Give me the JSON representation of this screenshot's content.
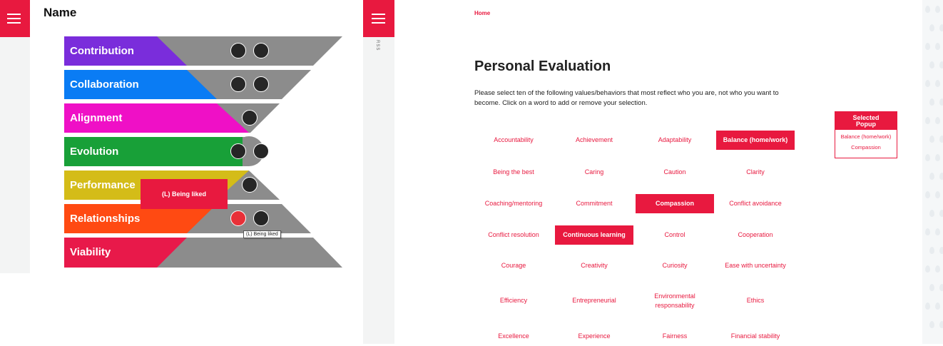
{
  "left": {
    "title": "Name",
    "rows": [
      {
        "label": "Contribution",
        "color": "#7a2ddb"
      },
      {
        "label": "Collaboration",
        "color": "#0a7cf4"
      },
      {
        "label": "Alignment",
        "color": "#ef10c6"
      },
      {
        "label": "Evolution",
        "color": "#18a038"
      },
      {
        "label": "Performance",
        "color": "#d4bc18"
      },
      {
        "label": "Relationships",
        "color": "#ff4a12"
      },
      {
        "label": "Viability",
        "color": "#e8194a"
      }
    ],
    "selected_tag": "(L) Being liked",
    "tooltip": "(L) Being liked"
  },
  "middle": {
    "vertical_text": "RSS"
  },
  "right": {
    "breadcrumb": "Home",
    "title": "Personal Evaluation",
    "intro": "Please select ten of the following values/behaviors that most reflect who you are, not who you want to become. Click on a word to add or remove your selection.",
    "words": [
      {
        "label": "Accountability",
        "selected": false
      },
      {
        "label": "Achievement",
        "selected": false
      },
      {
        "label": "Adaptability",
        "selected": false
      },
      {
        "label": "Balance (home/work)",
        "selected": true
      },
      {
        "label": "Being the best",
        "selected": false
      },
      {
        "label": "Caring",
        "selected": false
      },
      {
        "label": "Caution",
        "selected": false
      },
      {
        "label": "Clarity",
        "selected": false
      },
      {
        "label": "Coaching/mentoring",
        "selected": false
      },
      {
        "label": "Commitment",
        "selected": false
      },
      {
        "label": "Compassion",
        "selected": true
      },
      {
        "label": "Conflict avoidance",
        "selected": false
      },
      {
        "label": "Conflict resolution",
        "selected": false
      },
      {
        "label": "Continuous learning",
        "selected": true
      },
      {
        "label": "Control",
        "selected": false
      },
      {
        "label": "Cooperation",
        "selected": false
      },
      {
        "label": "Courage",
        "selected": false
      },
      {
        "label": "Creativity",
        "selected": false
      },
      {
        "label": "Curiosity",
        "selected": false
      },
      {
        "label": "Ease with uncertainty",
        "selected": false
      },
      {
        "label": "Efficiency",
        "selected": false
      },
      {
        "label": "Entrepreneurial",
        "selected": false
      },
      {
        "label": "Environmental responsability",
        "selected": false
      },
      {
        "label": "Ethics",
        "selected": false
      },
      {
        "label": "Excellence",
        "selected": false
      },
      {
        "label": "Experience",
        "selected": false
      },
      {
        "label": "Fairness",
        "selected": false
      },
      {
        "label": "Financial stability",
        "selected": false
      }
    ],
    "popup": {
      "title": "Selected Popup",
      "items": [
        "Balance (home/work)",
        "Compassion"
      ]
    }
  },
  "colors": {
    "accent": "#e8193f",
    "funnel_gray": "#8c8c8c"
  }
}
